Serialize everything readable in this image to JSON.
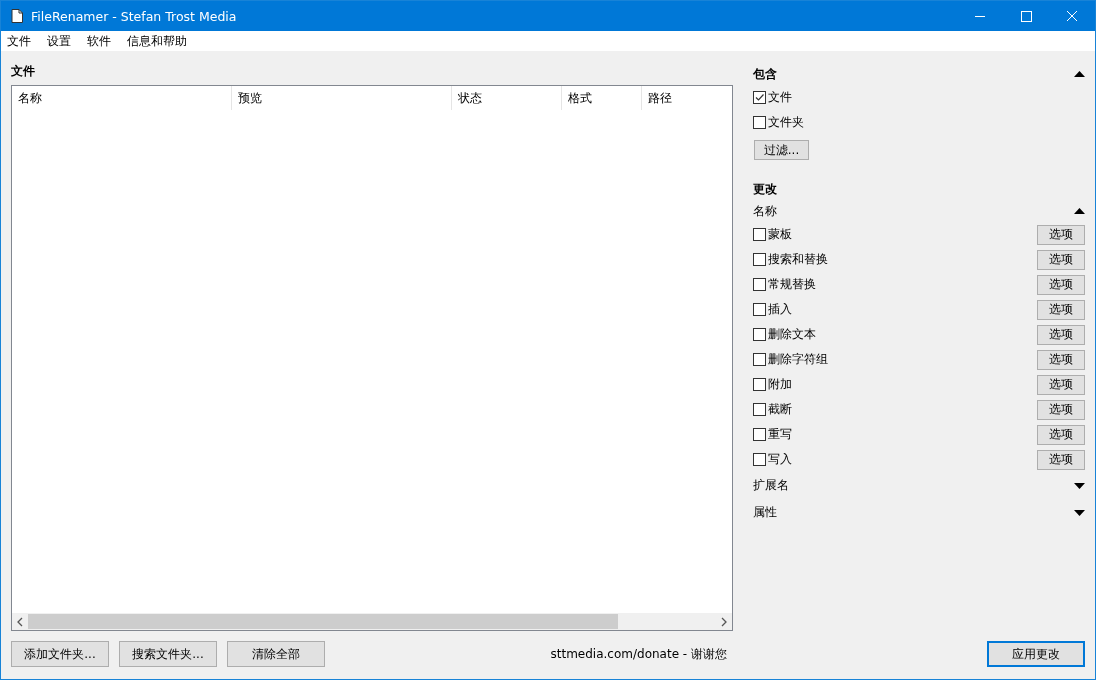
{
  "window": {
    "title": "FileRenamer - Stefan Trost Media"
  },
  "menu": [
    "文件",
    "设置",
    "软件",
    "信息和帮助"
  ],
  "files_panel": {
    "title": "文件",
    "columns": [
      "名称",
      "预览",
      "状态",
      "格式",
      "路径"
    ],
    "buttons": [
      "添加文件夹...",
      "搜索文件夹...",
      "清除全部"
    ],
    "donate": "sttmedia.com/donate - 谢谢您"
  },
  "include": {
    "title": "包含",
    "expanded": true,
    "options": [
      {
        "label": "文件",
        "checked": true
      },
      {
        "label": "文件夹",
        "checked": false
      }
    ],
    "filter_button": "过滤..."
  },
  "change": {
    "title": "更改",
    "name_section": {
      "title": "名称",
      "expanded": true,
      "items": [
        {
          "label": "蒙板",
          "checked": false,
          "button": "选项"
        },
        {
          "label": "搜索和替换",
          "checked": false,
          "button": "选项"
        },
        {
          "label": "常规替换",
          "checked": false,
          "button": "选项"
        },
        {
          "label": "插入",
          "checked": false,
          "button": "选项"
        },
        {
          "label": "删除文本",
          "checked": false,
          "button": "选项"
        },
        {
          "label": "删除字符组",
          "checked": false,
          "button": "选项"
        },
        {
          "label": "附加",
          "checked": false,
          "button": "选项"
        },
        {
          "label": "截断",
          "checked": false,
          "button": "选项"
        },
        {
          "label": "重写",
          "checked": false,
          "button": "选项"
        },
        {
          "label": "写入",
          "checked": false,
          "button": "选项"
        }
      ]
    },
    "sections": [
      {
        "title": "扩展名",
        "expanded": false
      },
      {
        "title": "属性",
        "expanded": false
      }
    ]
  },
  "apply_button": "应用更改"
}
